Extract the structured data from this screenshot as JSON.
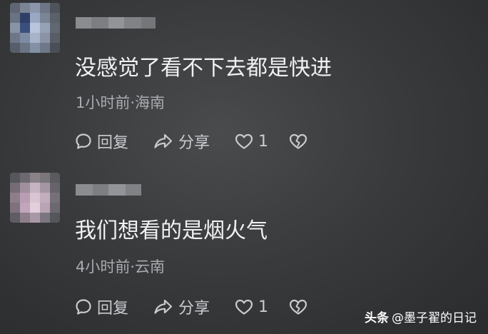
{
  "comments": [
    {
      "text": "没感觉了看不下去都是快进",
      "meta": "1小时前·海南",
      "reply_label": "回复",
      "share_label": "分享",
      "like_count": "1",
      "icons": [
        "chat-bubble-icon",
        "share-arrow-icon",
        "heart-icon",
        "broken-heart-icon"
      ]
    },
    {
      "text": "我们想看的是烟火气",
      "meta": "4小时前·云南",
      "reply_label": "回复",
      "share_label": "分享",
      "like_count": "1",
      "icons": [
        "chat-bubble-icon",
        "share-arrow-icon",
        "heart-icon",
        "broken-heart-icon"
      ]
    }
  ],
  "watermark": {
    "brand": "头条",
    "author": "@墨子翟的日记"
  },
  "colors": {
    "background": "#3a3b3d",
    "text": "#f0f1f3",
    "meta": "#a9abb0",
    "icon": "#c9cbcf"
  }
}
